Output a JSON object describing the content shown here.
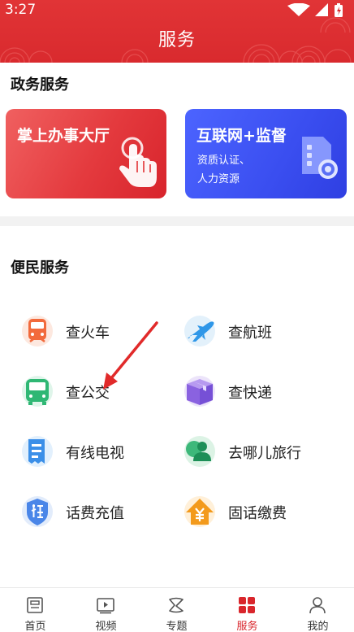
{
  "status_bar": {
    "time": "3:27"
  },
  "header": {
    "title": "服务"
  },
  "government": {
    "title": "政务服务",
    "cards": [
      {
        "title": "掌上办事大厅",
        "icon": "hand-tap-icon"
      },
      {
        "title": "互联网+监督",
        "subtitle_lines": [
          "资质认证、",
          "人力资源"
        ],
        "icon": "document-gear-icon"
      }
    ]
  },
  "convenience": {
    "title": "便民服务",
    "items": [
      {
        "label": "查火车",
        "icon": "train-icon"
      },
      {
        "label": "查航班",
        "icon": "plane-icon"
      },
      {
        "label": "查公交",
        "icon": "bus-icon"
      },
      {
        "label": "查快递",
        "icon": "parcel-box-icon"
      },
      {
        "label": "有线电视",
        "icon": "tv-document-icon"
      },
      {
        "label": "去哪儿旅行",
        "icon": "travel-user-icon"
      },
      {
        "label": "话费充值",
        "icon": "shield-social-icon"
      },
      {
        "label": "固话缴费",
        "icon": "yuan-house-icon"
      }
    ]
  },
  "tabbar": {
    "items": [
      {
        "label": "首页",
        "icon": "home-icon",
        "active": false
      },
      {
        "label": "视频",
        "icon": "video-icon",
        "active": false
      },
      {
        "label": "专题",
        "icon": "topic-icon",
        "active": false
      },
      {
        "label": "服务",
        "icon": "service-grid-icon",
        "active": true
      },
      {
        "label": "我的",
        "icon": "profile-icon",
        "active": false
      }
    ]
  },
  "colors": {
    "brand_red": "#d9262c",
    "card_blue": "#3a4ef0"
  }
}
